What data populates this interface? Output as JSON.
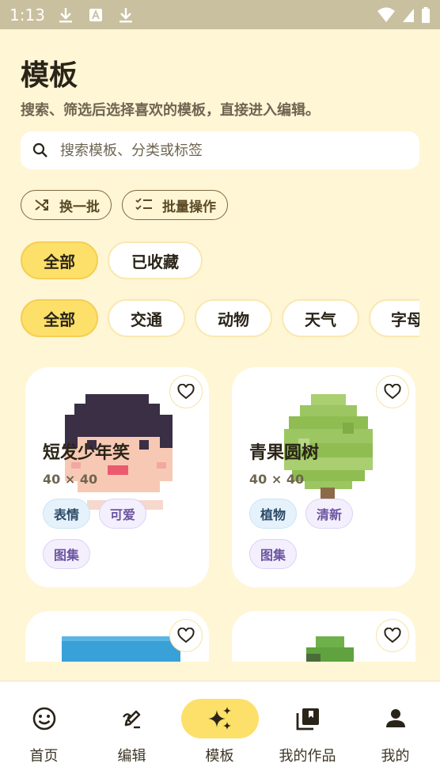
{
  "status_bar": {
    "time": "1:13"
  },
  "header": {
    "title": "模板",
    "subtitle": "搜索、筛选后选择喜欢的模板，直接进入编辑。"
  },
  "search": {
    "placeholder": "搜索模板、分类或标签",
    "value": ""
  },
  "actions": {
    "shuffle_label": "换一批",
    "batch_label": "批量操作"
  },
  "filters": [
    {
      "label": "全部",
      "active": true
    },
    {
      "label": "已收藏",
      "active": false
    }
  ],
  "categories": [
    {
      "label": "全部",
      "active": true
    },
    {
      "label": "交通",
      "active": false
    },
    {
      "label": "动物",
      "active": false
    },
    {
      "label": "天气",
      "active": false
    },
    {
      "label": "字母",
      "active": false
    }
  ],
  "cards": [
    {
      "title": "短发少年笑",
      "size": "40 × 40",
      "tags": [
        "表情",
        "可爱",
        "图集"
      ]
    },
    {
      "title": "青果圆树",
      "size": "40 × 40",
      "tags": [
        "植物",
        "清新",
        "图集"
      ]
    }
  ],
  "nav": {
    "items": [
      {
        "label": "首页",
        "icon": "smiley-icon"
      },
      {
        "label": "编辑",
        "icon": "edit-icon"
      },
      {
        "label": "模板",
        "icon": "sparkle-icon",
        "active": true
      },
      {
        "label": "我的作品",
        "icon": "collections-icon"
      },
      {
        "label": "我的",
        "icon": "person-icon"
      }
    ]
  },
  "colors": {
    "background": "#fff6d6",
    "accent": "#fde069",
    "tag_blue": "#e5f2fc",
    "tag_purple": "#f4effd"
  }
}
